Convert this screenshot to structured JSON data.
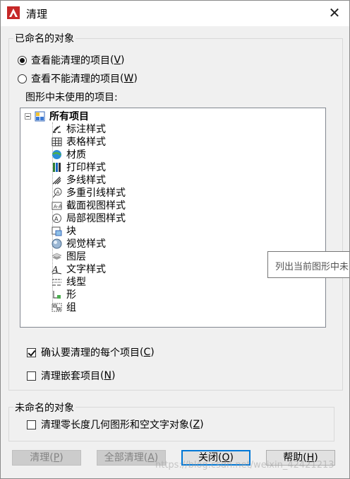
{
  "window": {
    "title": "清理",
    "close_glyph": "✕"
  },
  "named_group": {
    "label": "已命名的对象",
    "radio_view_purgeable": {
      "text": "查看能清理的项目",
      "key": "V",
      "selected": true
    },
    "radio_view_nonpurgeable": {
      "text": "查看不能清理的项目",
      "key": "W",
      "selected": false
    },
    "unused_label": "图形中未使用的项目:",
    "tree": {
      "root": "所有项目",
      "items": [
        {
          "label": "标注样式",
          "icon": "dimension-style-icon"
        },
        {
          "label": "表格样式",
          "icon": "table-style-icon"
        },
        {
          "label": "材质",
          "icon": "material-icon"
        },
        {
          "label": "打印样式",
          "icon": "plot-style-icon"
        },
        {
          "label": "多线样式",
          "icon": "multiline-style-icon"
        },
        {
          "label": "多重引线样式",
          "icon": "multileader-style-icon"
        },
        {
          "label": "截面视图样式",
          "icon": "section-view-style-icon"
        },
        {
          "label": "局部视图样式",
          "icon": "detail-view-style-icon"
        },
        {
          "label": "块",
          "icon": "block-icon"
        },
        {
          "label": "视觉样式",
          "icon": "visual-style-icon"
        },
        {
          "label": "图层",
          "icon": "layer-icon"
        },
        {
          "label": "文字样式",
          "icon": "text-style-icon"
        },
        {
          "label": "线型",
          "icon": "linetype-icon"
        },
        {
          "label": "形",
          "icon": "shape-icon"
        },
        {
          "label": "组",
          "icon": "group-icon"
        }
      ]
    },
    "check_confirm": {
      "text": "确认要清理的每个项目",
      "key": "C",
      "checked": true
    },
    "check_nested": {
      "text": "清理嵌套项目",
      "key": "N",
      "checked": false
    }
  },
  "unnamed_group": {
    "label": "未命名的对象",
    "check_zero_length": {
      "text": "清理零长度几何图形和空文字对象",
      "key": "Z",
      "checked": false
    }
  },
  "tooltip": "列出当前图形中未",
  "buttons": {
    "purge": {
      "text": "清理",
      "key": "P"
    },
    "purge_all": {
      "text": "全部清理",
      "key": "A"
    },
    "close": {
      "text": "关闭",
      "key": "O"
    },
    "help": {
      "text": "帮助",
      "key": "H"
    }
  },
  "watermark": "https://blog.csdn.net/weixin_42421213",
  "colors": {
    "accent": "#0078d7",
    "app_icon": "#d32f2f",
    "window_bg": "#f0f0f0"
  }
}
